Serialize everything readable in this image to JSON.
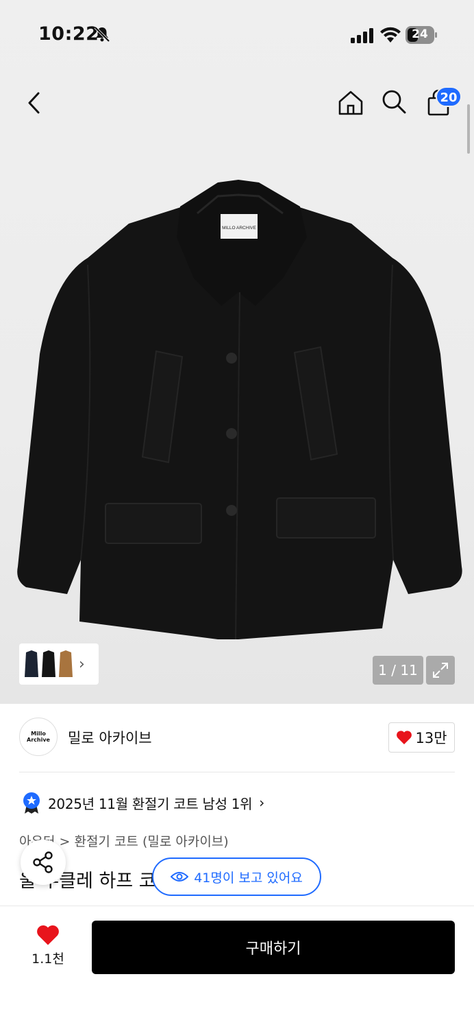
{
  "status": {
    "time": "10:22",
    "battery": "24"
  },
  "nav": {
    "cart_count": "20"
  },
  "gallery": {
    "counter": "1 / 11",
    "label_on_garment": "MILLO ARCHIVE"
  },
  "brand": {
    "logo_text": "Millo Archive",
    "name": "밀로 아카이브",
    "likes": "13만"
  },
  "ranking": {
    "text": "2025년 11월 환절기 코트 남성 1위"
  },
  "breadcrumb": {
    "parent": "아우터",
    "separator": ">",
    "child": "환절기 코트 (밀로 아카이브)"
  },
  "product": {
    "title": "울 부클레 하프 코트 [블랙]"
  },
  "viewing": {
    "text": "41명이 보고 있어요"
  },
  "bottom": {
    "wish_count": "1.1천",
    "buy_label": "구매하기"
  },
  "colors": {
    "accent": "#1f6bff",
    "heart": "#e8141c",
    "buy_bg": "#000000"
  }
}
